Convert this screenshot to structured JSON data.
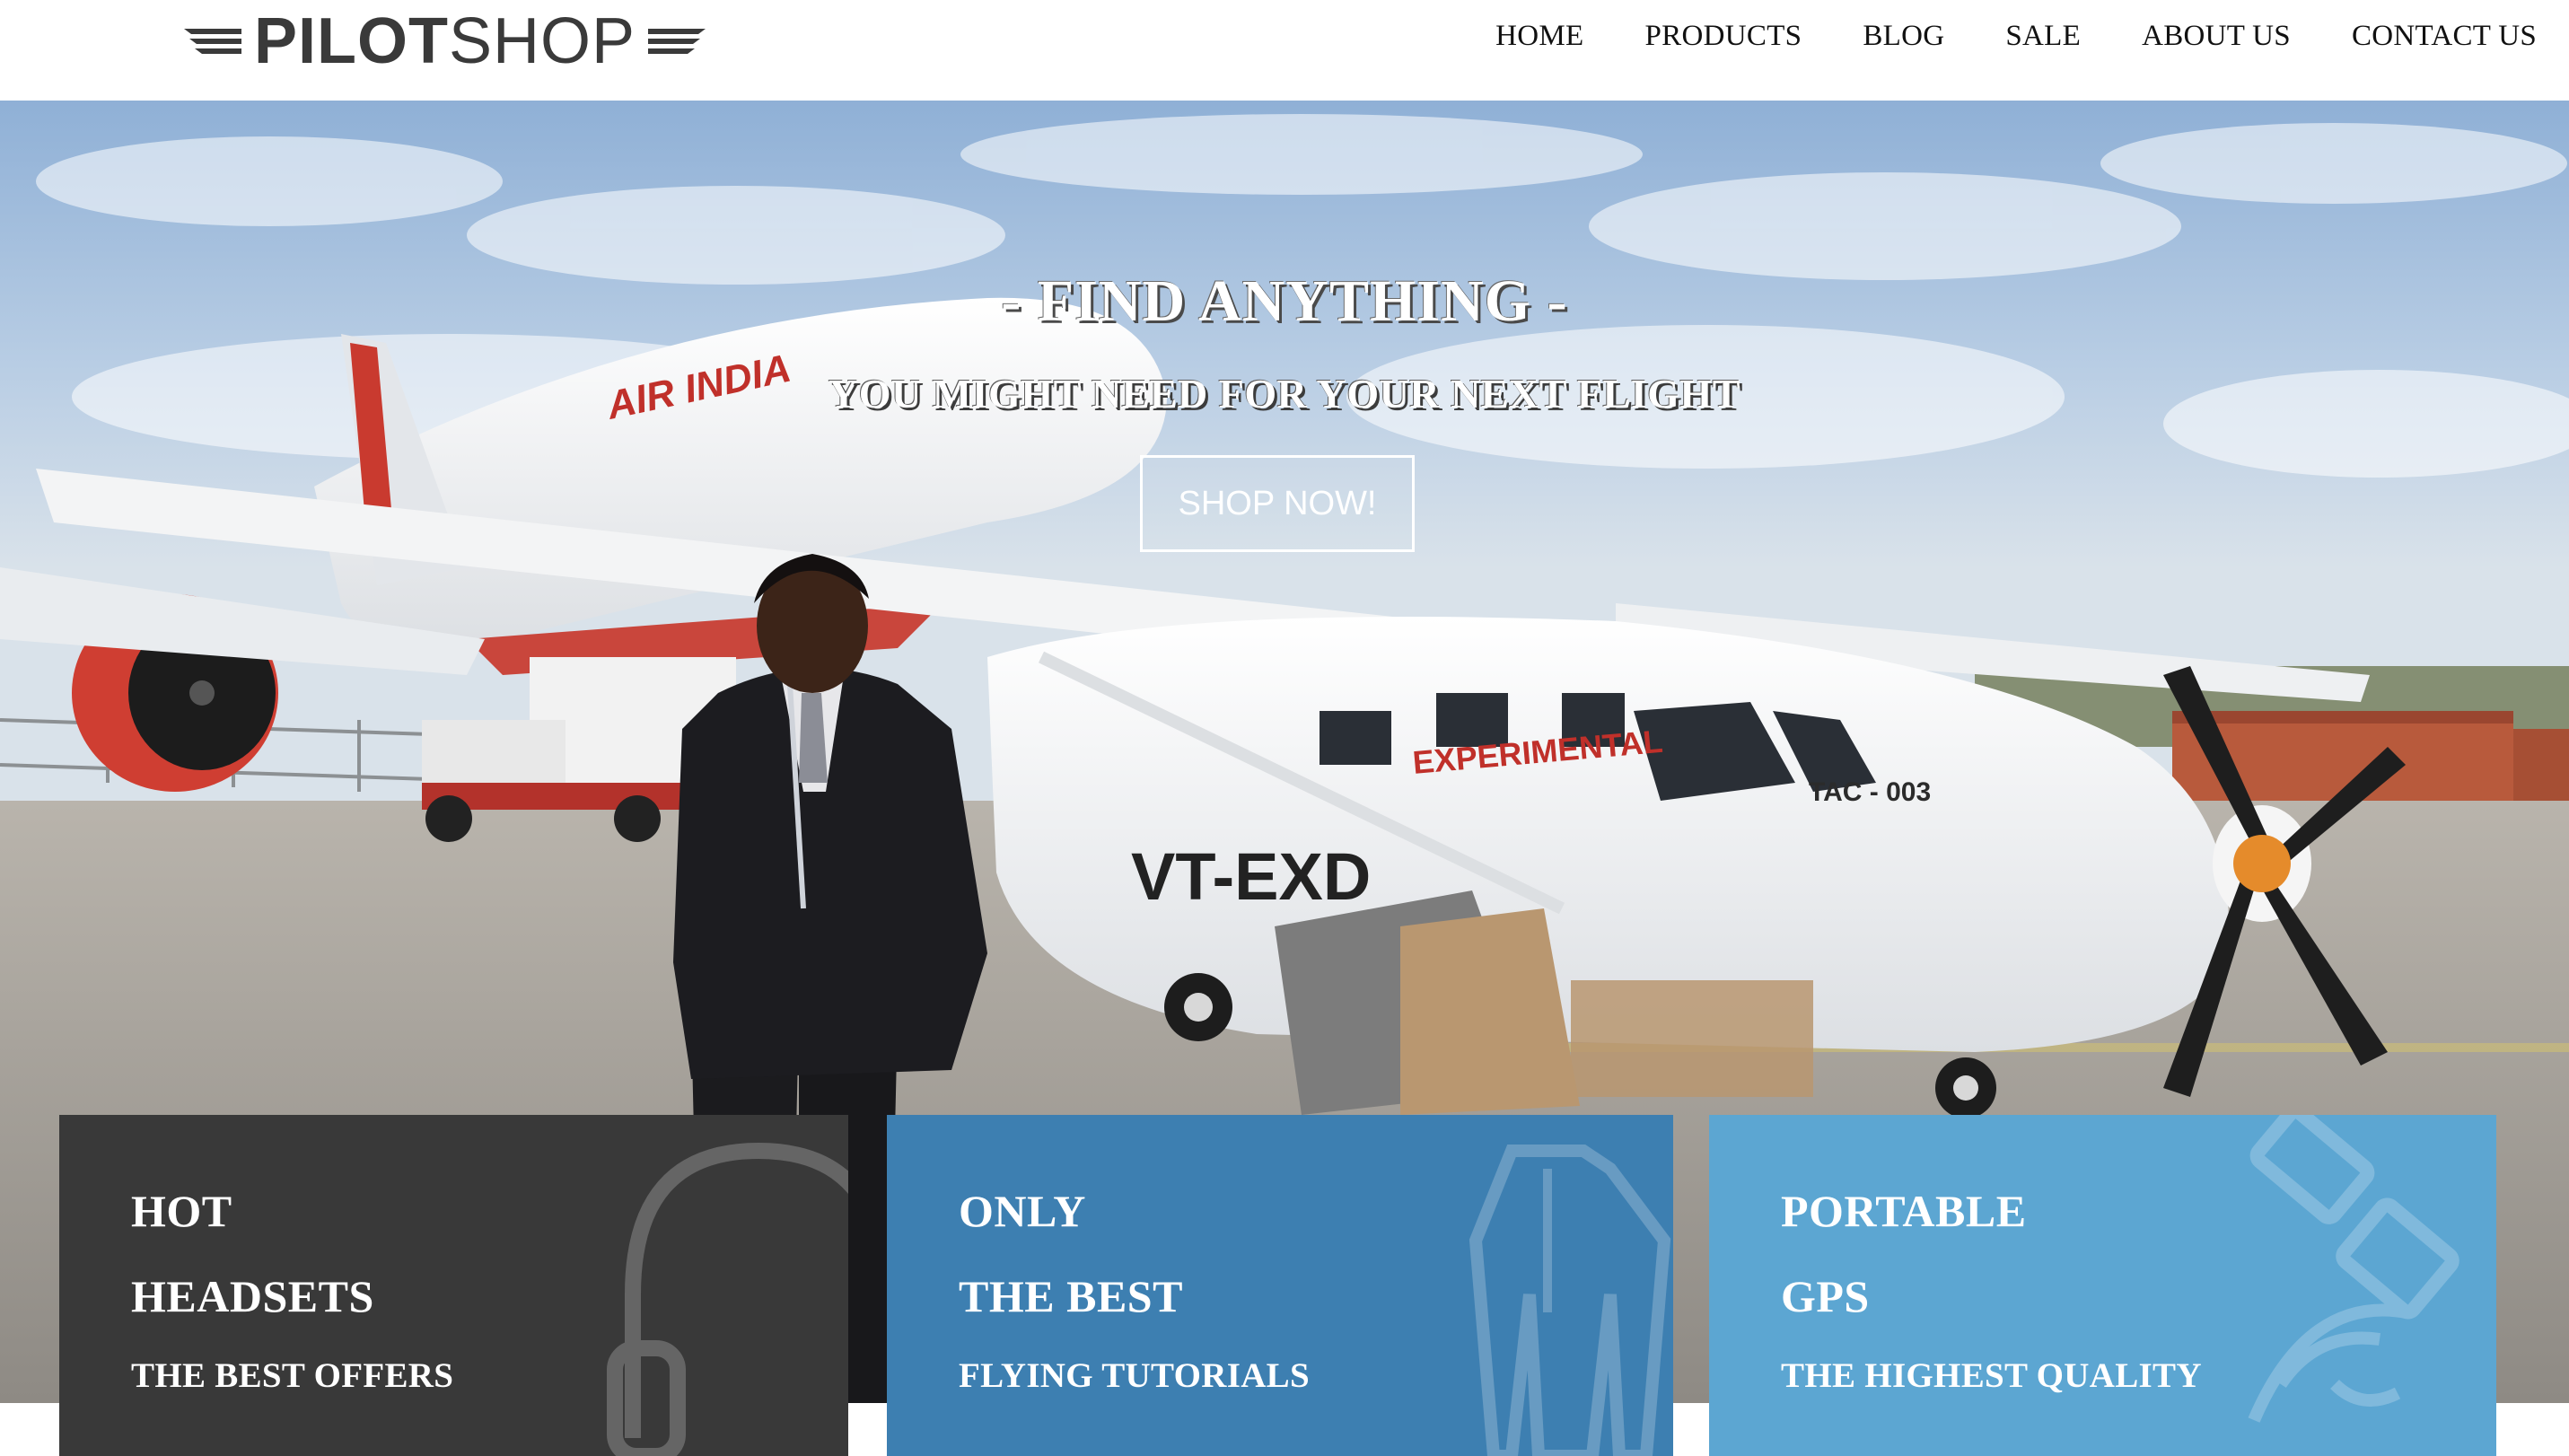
{
  "brand": {
    "logo_bold": "PILOT",
    "logo_light": "SHOP"
  },
  "nav": {
    "items": [
      {
        "label": "HOME"
      },
      {
        "label": "PRODUCTS"
      },
      {
        "label": "BLOG"
      },
      {
        "label": "SALE"
      },
      {
        "label": "ABOUT US"
      },
      {
        "label": "CONTACT US"
      }
    ]
  },
  "hero": {
    "title": "- FIND ANYTHING -",
    "subtitle": "YOU MIGHT NEED FOR YOUR NEXT FLIGHT",
    "cta_label": "SHOP NOW!",
    "photo_text": {
      "airline": "AIR INDIA",
      "experimental": "EXPERIMENTAL",
      "registration": "VT-EXD",
      "tail": "TAC - 003"
    }
  },
  "features": [
    {
      "line1": "HOT",
      "line2": "HEADSETS",
      "line3": "THE BEST OFFERS",
      "icon": "headphones-icon",
      "color": "#393939"
    },
    {
      "line1": "ONLY",
      "line2": "THE BEST",
      "line3": "FLYING TUTORIALS",
      "icon": "flight-suit-icon",
      "color": "#3d7fb1"
    },
    {
      "line1": "PORTABLE",
      "line2": "GPS",
      "line3": "THE HIGHEST QUALITY",
      "icon": "satellite-icon",
      "color": "#5ca6d2"
    }
  ],
  "colors": {
    "header_bg": "#ffffff",
    "nav_text": "#111111",
    "logo": "#3a3a3a",
    "feature_dark": "#393939",
    "feature_mid": "#3d7fb1",
    "feature_light": "#5ca6d2"
  }
}
